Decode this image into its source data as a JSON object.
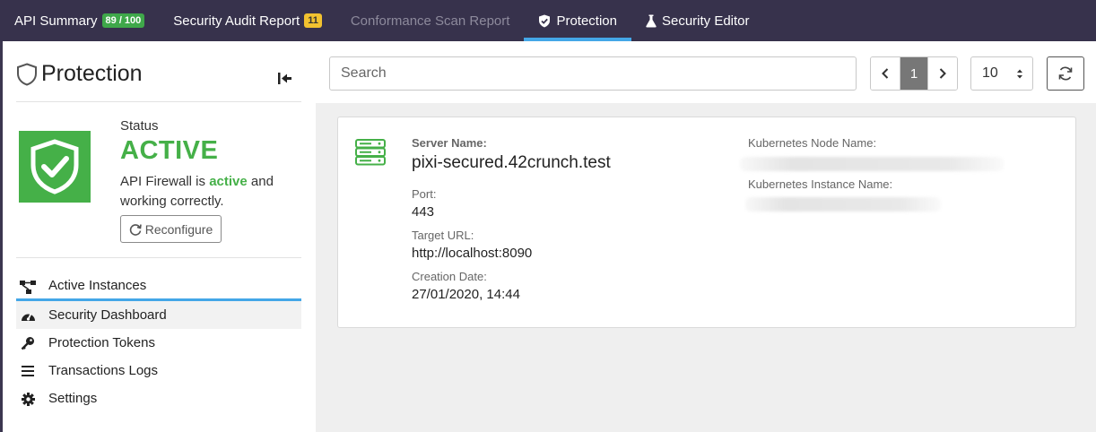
{
  "topnav": {
    "tabs": [
      {
        "label": "API Summary",
        "badge": "89 / 100"
      },
      {
        "label": "Security Audit Report",
        "badge": "11"
      },
      {
        "label": "Conformance Scan Report"
      },
      {
        "label": "Protection"
      },
      {
        "label": "Security Editor"
      }
    ]
  },
  "sidebar": {
    "title": "Protection",
    "status_label": "Status",
    "status_value": "ACTIVE",
    "status_text_prefix": "API Firewall is ",
    "status_text_highlight": "active",
    "status_text_suffix": " and working correctly.",
    "reconfigure_label": "Reconfigure",
    "menu": [
      {
        "label": "Active Instances",
        "icon": "network-icon"
      },
      {
        "label": "Security Dashboard",
        "icon": "dashboard-icon"
      },
      {
        "label": "Protection Tokens",
        "icon": "key-icon"
      },
      {
        "label": "Transactions Logs",
        "icon": "list-icon"
      },
      {
        "label": "Settings",
        "icon": "gear-icon"
      }
    ]
  },
  "toolbar": {
    "search_placeholder": "Search",
    "current_page": "1",
    "per_page": "10"
  },
  "instance": {
    "server_name_label": "Server Name:",
    "server_name": "pixi-secured.42crunch.test",
    "port_label": "Port:",
    "port": "443",
    "target_url_label": "Target URL:",
    "target_url": "http://localhost:8090",
    "creation_date_label": "Creation Date:",
    "creation_date": "27/01/2020, 14:44",
    "k8s_node_label": "Kubernetes Node Name:",
    "k8s_instance_label": "Kubernetes Instance Name:"
  },
  "colors": {
    "nav_bg": "#37324c",
    "accent_blue": "#44a7e7",
    "status_green": "#45b048",
    "badge_yellow": "#f2c230"
  }
}
